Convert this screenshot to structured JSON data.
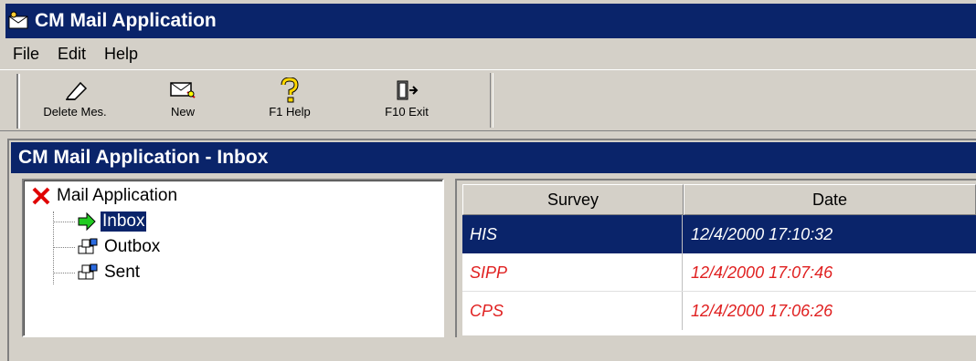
{
  "window": {
    "title": "CM Mail Application"
  },
  "menu": {
    "items": [
      "File",
      "Edit",
      "Help"
    ]
  },
  "toolbar": {
    "buttons": [
      {
        "label": "Delete Mes.",
        "icon": "eraser-icon"
      },
      {
        "label": "New",
        "icon": "new-mail-icon"
      },
      {
        "label": "F1 Help",
        "icon": "help-question-icon"
      },
      {
        "label": "F10 Exit",
        "icon": "exit-door-icon"
      }
    ]
  },
  "subwindow": {
    "title": "CM Mail Application - Inbox"
  },
  "tree": {
    "root": {
      "label": "Mail Application",
      "icon": "red-x-icon"
    },
    "children": [
      {
        "label": "Inbox",
        "icon": "green-arrow-icon",
        "selected": true
      },
      {
        "label": "Outbox",
        "icon": "cubes-icon"
      },
      {
        "label": "Sent",
        "icon": "cubes-icon"
      }
    ]
  },
  "list": {
    "columns": [
      "Survey",
      "Date"
    ],
    "rows": [
      {
        "survey": "HIS",
        "date": "12/4/2000 17:10:32",
        "selected": true,
        "color": "#ffffff"
      },
      {
        "survey": "SIPP",
        "date": "12/4/2000 17:07:46",
        "color": "#e02020"
      },
      {
        "survey": "CPS",
        "date": "12/4/2000 17:06:26",
        "color": "#e02020"
      }
    ]
  },
  "colors": {
    "titlebar": "#0a246a",
    "selection": "#0a246a",
    "unread_text": "#e02020",
    "face": "#d4d0c8"
  }
}
